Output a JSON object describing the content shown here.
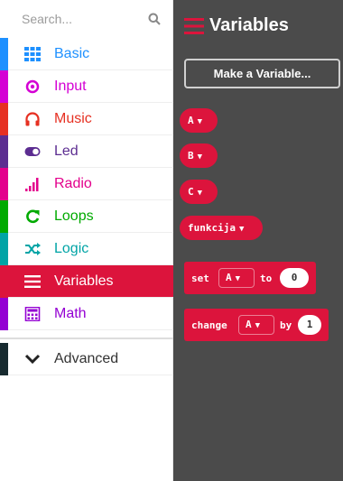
{
  "search": {
    "placeholder": "Search..."
  },
  "categories": [
    {
      "label": "Basic",
      "icon": "grid-icon",
      "color": "#1e90ff"
    },
    {
      "label": "Input",
      "icon": "circle-dot-icon",
      "color": "#d400d4"
    },
    {
      "label": "Music",
      "icon": "headphones-icon",
      "color": "#e63022"
    },
    {
      "label": "Led",
      "icon": "toggle-icon",
      "color": "#5c2d91"
    },
    {
      "label": "Radio",
      "icon": "signal-bars-icon",
      "color": "#e3008c"
    },
    {
      "label": "Loops",
      "icon": "refresh-icon",
      "color": "#00aa00"
    },
    {
      "label": "Logic",
      "icon": "shuffle-icon",
      "color": "#00a4a6"
    },
    {
      "label": "Variables",
      "icon": "list-icon",
      "color": "#dc143c"
    },
    {
      "label": "Math",
      "icon": "calculator-icon",
      "color": "#9400d3"
    }
  ],
  "advanced": {
    "label": "Advanced",
    "icon": "chevron-down-icon"
  },
  "flyout": {
    "title": "Variables",
    "make_variable_label": "Make a Variable...",
    "variables": [
      "A",
      "B",
      "C",
      "funkcija"
    ],
    "set_block": {
      "keyword_set": "set",
      "variable": "A",
      "keyword_to": "to",
      "value": "0"
    },
    "change_block": {
      "keyword_change": "change",
      "variable": "A",
      "keyword_by": "by",
      "value": "1"
    }
  }
}
